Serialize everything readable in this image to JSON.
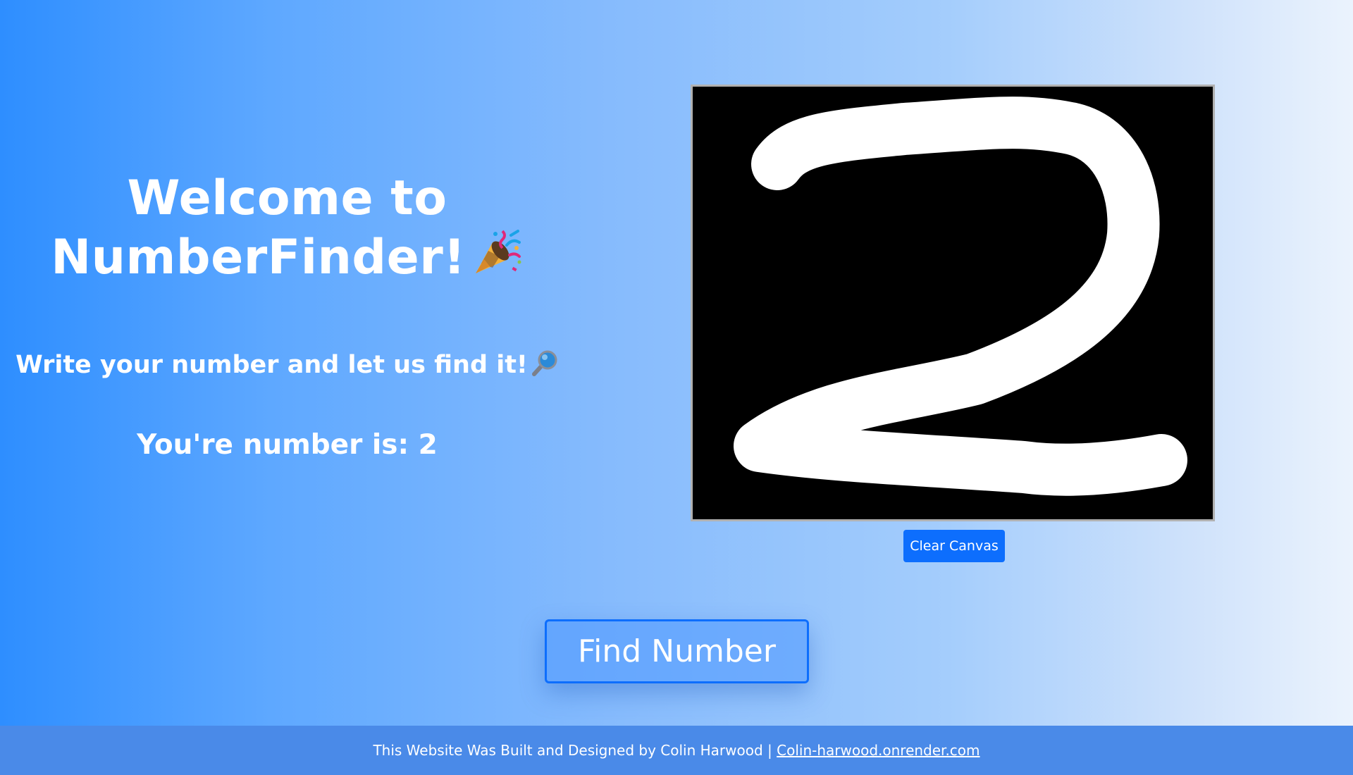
{
  "header": {
    "title_line1": "Welcome to",
    "title_line2": "NumberFinder!",
    "title_emoji_icon": "party-popper-icon",
    "subtitle": "Write your number and let us find it!",
    "subtitle_emoji_icon": "magnifying-glass-icon",
    "result_text": "You're number is: 2"
  },
  "canvas": {
    "background_color": "#000000",
    "stroke_color": "#ffffff",
    "drawn_content": "handwritten digit 2"
  },
  "buttons": {
    "clear_label": "Clear Canvas",
    "find_label": "Find Number"
  },
  "footer": {
    "text": "This Website Was Built and Designed by Colin Harwood |",
    "link_text": "Colin-harwood.onrender.com"
  },
  "colors": {
    "primary": "#0d6efd",
    "footer_bg": "#4a8ae8",
    "gradient_start": "#2e8eff",
    "gradient_end": "#ebf3fd"
  }
}
